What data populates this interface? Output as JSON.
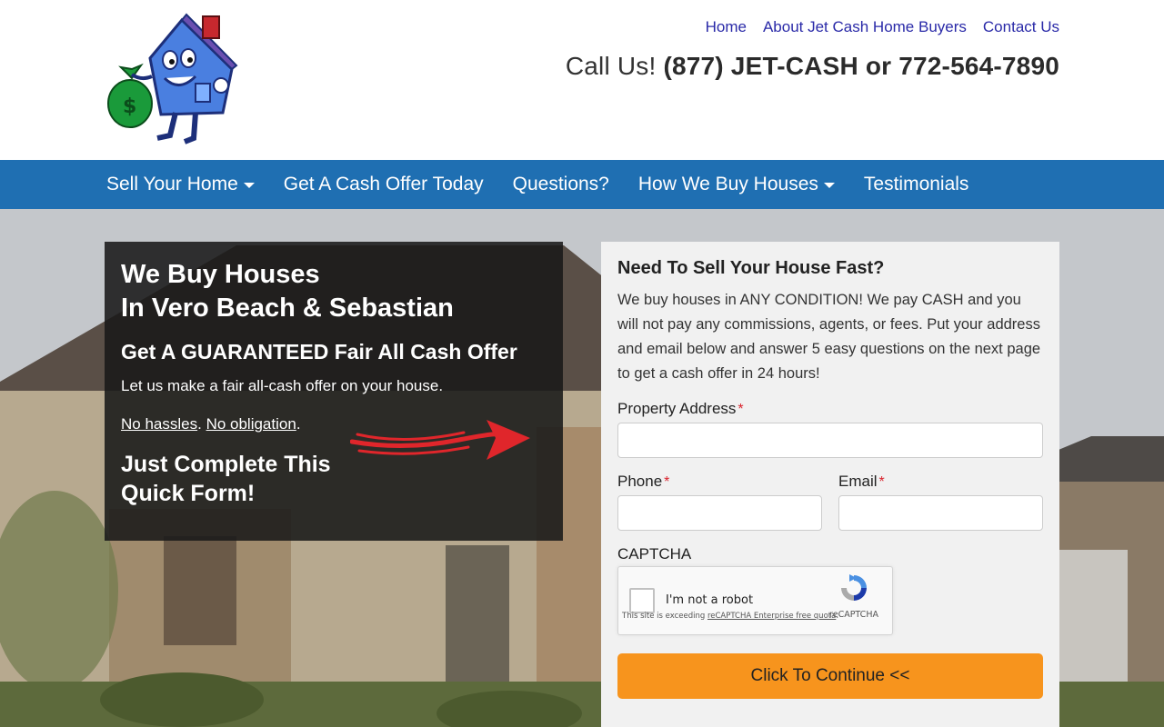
{
  "header": {
    "top_links": [
      "Home",
      "About Jet Cash Home Buyers",
      "Contact Us"
    ],
    "callus_prefix": "Call Us!",
    "callus_numbers": "(877) JET-CASH or 772-564-7890"
  },
  "nav": {
    "items": [
      {
        "label": "Sell Your Home",
        "dropdown": true
      },
      {
        "label": "Get A Cash Offer Today",
        "dropdown": false
      },
      {
        "label": "Questions?",
        "dropdown": false
      },
      {
        "label": "How We Buy Houses",
        "dropdown": true
      },
      {
        "label": "Testimonials",
        "dropdown": false
      }
    ]
  },
  "hero": {
    "title_line1": "We Buy Houses",
    "title_line2": "In Vero Beach & Sebastian",
    "subtitle": "Get A GUARANTEED Fair All Cash Offer",
    "desc": "Let us make a fair all-cash offer on your house.",
    "no_hassles": "No hassles",
    "no_obligation": "No obligation",
    "cta_line1": "Just Complete This",
    "cta_line2": "Quick Form!"
  },
  "form": {
    "heading": "Need To Sell Your House Fast?",
    "intro": "We buy houses in ANY CONDITION! We pay CASH and you will not pay any commissions, agents, or fees. Put your address and email below and answer 5 easy questions on the next page to get a cash offer in 24 hours!",
    "property_label": "Property Address",
    "phone_label": "Phone",
    "email_label": "Email",
    "required_mark": "*",
    "captcha_label": "CAPTCHA",
    "recaptcha_text": "I'm not a robot",
    "recaptcha_brand": "reCAPTCHA",
    "recaptcha_note_prefix": "This site is exceeding ",
    "recaptcha_note_link": "reCAPTCHA Enterprise free quota",
    "submit_label": "Click To Continue <<"
  },
  "colors": {
    "nav_bg": "#1f6fb2",
    "button": "#f7941d",
    "dark_panel": "#191919",
    "required": "#d9232d"
  }
}
